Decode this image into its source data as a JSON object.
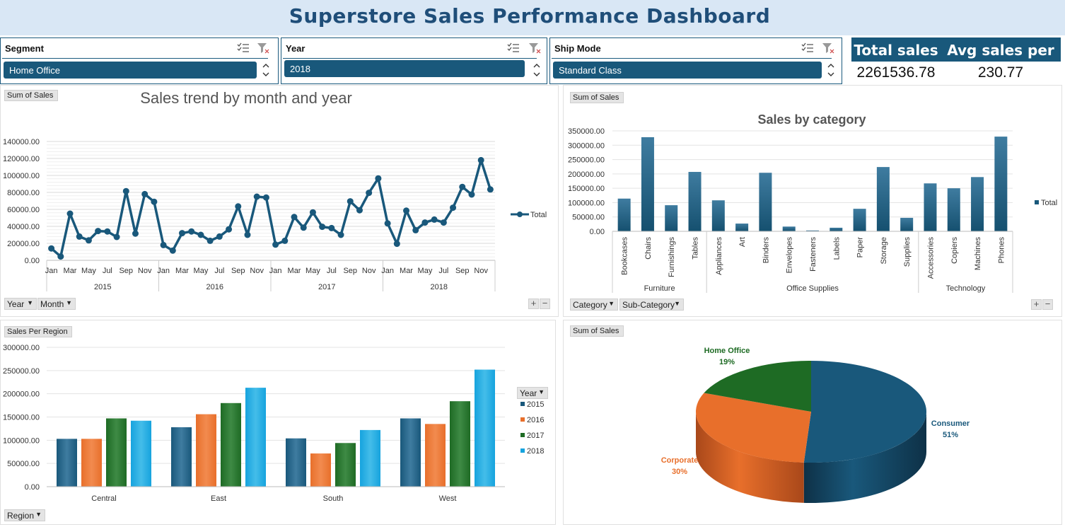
{
  "title": "Superstore Sales Performance Dashboard",
  "slicers": [
    {
      "title": "Segment",
      "value": "Home Office"
    },
    {
      "title": "Year",
      "value": "2018"
    },
    {
      "title": "Ship Mode",
      "value": "Standard Class"
    }
  ],
  "kpis": {
    "total_label": "Total sales",
    "total_value": "2261536.78",
    "avg_label": "Avg sales per row",
    "avg_value": "230.77"
  },
  "colors": {
    "navy": "#19587b",
    "orange": "#e86f2b",
    "green": "#1e6b24",
    "blue": "#16a3de"
  },
  "trend_panel": {
    "field_button": "Sum of Sales",
    "filter_year": "Year",
    "filter_month": "Month",
    "plus": "+",
    "minus": "−"
  },
  "category_panel": {
    "field_button": "Sum of Sales",
    "filter_category": "Category",
    "filter_subcategory": "Sub-Category",
    "plus": "+",
    "minus": "−"
  },
  "region_panel": {
    "field_button": "Sales Per Region",
    "filter_region": "Region",
    "legend_title": "Year"
  },
  "pie_panel": {
    "field_button": "Sum of Sales"
  },
  "chart_data": [
    {
      "type": "line",
      "title": "Sales trend by month and year",
      "legend": [
        "Total"
      ],
      "legend_position": "right",
      "ylim": [
        0,
        140000
      ],
      "yticks": [
        "0.00",
        "20000.00",
        "40000.00",
        "60000.00",
        "80000.00",
        "100000.00",
        "120000.00",
        "140000.00"
      ],
      "month_tick_labels": [
        "Jan",
        "Mar",
        "May",
        "Jul",
        "Sep",
        "Nov"
      ],
      "years": [
        "2015",
        "2016",
        "2017",
        "2018"
      ],
      "series": [
        {
          "name": "Total",
          "values": [
            14000,
            4500,
            55000,
            28000,
            23500,
            34500,
            34000,
            27500,
            81500,
            31500,
            78000,
            69000,
            18000,
            11500,
            32000,
            34000,
            30000,
            23000,
            28000,
            36500,
            63500,
            30000,
            75000,
            74000,
            18500,
            23000,
            51000,
            38500,
            56500,
            39500,
            38000,
            30000,
            69500,
            59000,
            79500,
            96500,
            43500,
            19500,
            58500,
            35500,
            44500,
            48000,
            44500,
            62000,
            86500,
            77500,
            118000,
            83500
          ]
        }
      ]
    },
    {
      "type": "bar",
      "title": "Sales by category",
      "legend": [
        "Total"
      ],
      "legend_position": "right",
      "ylim": [
        0,
        350000
      ],
      "yticks": [
        "0.00",
        "50000.00",
        "100000.00",
        "150000.00",
        "200000.00",
        "250000.00",
        "300000.00",
        "350000.00"
      ],
      "groups": [
        {
          "name": "Furniture",
          "categories": [
            "Bookcases",
            "Chairs",
            "Furnishings",
            "Tables"
          ],
          "values": [
            114000,
            328000,
            91000,
            207000
          ]
        },
        {
          "name": "Office Supplies",
          "categories": [
            "Appliances",
            "Art",
            "Binders",
            "Envelopes",
            "Fasteners",
            "Labels",
            "Paper",
            "Storage",
            "Supplies"
          ],
          "values": [
            108000,
            27000,
            204000,
            16500,
            3000,
            12500,
            78500,
            224000,
            47000
          ]
        },
        {
          "name": "Technology",
          "categories": [
            "Accessories",
            "Copiers",
            "Machines",
            "Phones"
          ],
          "values": [
            167000,
            150000,
            189000,
            330000
          ]
        }
      ]
    },
    {
      "type": "bar",
      "title": "",
      "ylim": [
        0,
        300000
      ],
      "yticks": [
        "0.00",
        "50000.00",
        "100000.00",
        "150000.00",
        "200000.00",
        "250000.00",
        "300000.00"
      ],
      "categories": [
        "Central",
        "East",
        "South",
        "West"
      ],
      "legend_position": "right",
      "series": [
        {
          "name": "2015",
          "values": [
            103000,
            128000,
            104000,
            147000
          ]
        },
        {
          "name": "2016",
          "values": [
            103000,
            156000,
            71500,
            135000
          ]
        },
        {
          "name": "2017",
          "values": [
            147000,
            180000,
            94000,
            184000
          ]
        },
        {
          "name": "2018",
          "values": [
            142000,
            213000,
            122000,
            252000
          ]
        }
      ]
    },
    {
      "type": "pie",
      "title": "",
      "slices": [
        {
          "label": "Consumer",
          "percent": "51%",
          "value": 51
        },
        {
          "label": "Corporate",
          "percent": "30%",
          "value": 30
        },
        {
          "label": "Home Office",
          "percent": "19%",
          "value": 19
        }
      ]
    }
  ]
}
